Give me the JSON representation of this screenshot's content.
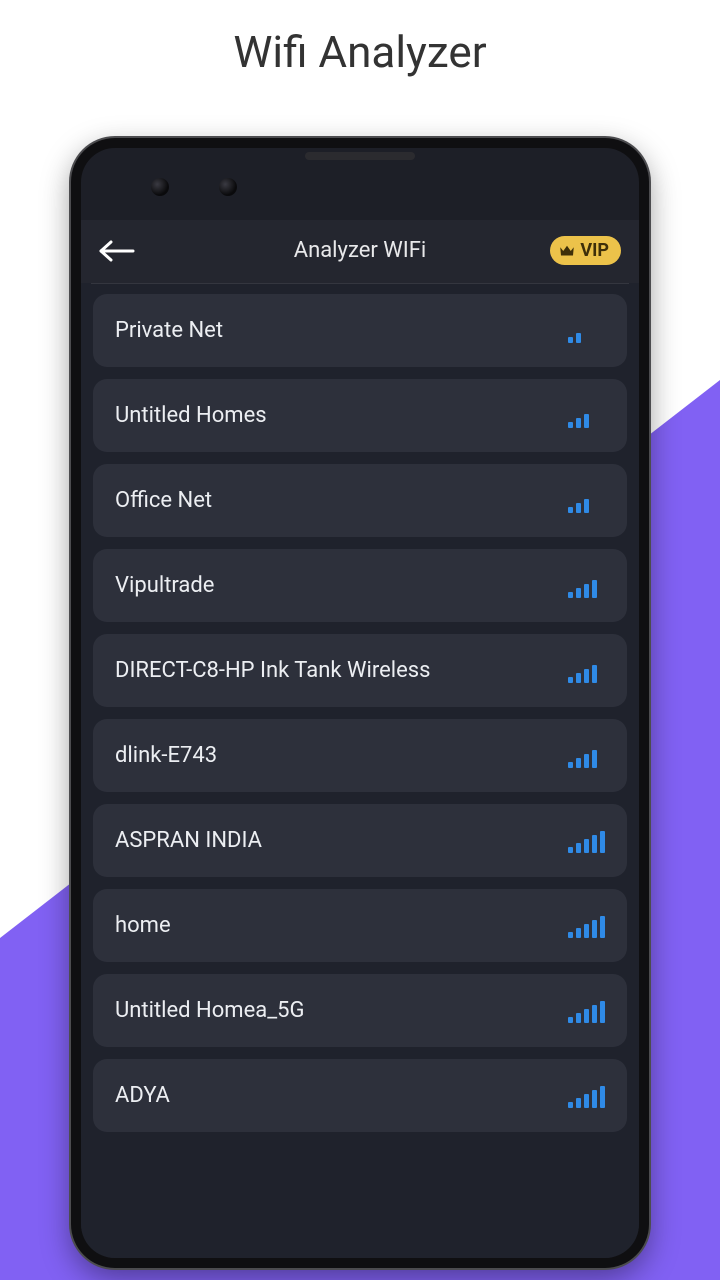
{
  "page": {
    "title": "Wifi Analyzer"
  },
  "header": {
    "title": "Analyzer WIFi",
    "vip_label": "VIP"
  },
  "networks": [
    {
      "name": "Private Net",
      "signal_bars": 2
    },
    {
      "name": "Untitled Homes",
      "signal_bars": 3
    },
    {
      "name": "Office Net",
      "signal_bars": 3
    },
    {
      "name": "Vipultrade",
      "signal_bars": 4
    },
    {
      "name": "DIRECT-C8-HP Ink Tank Wireless",
      "signal_bars": 4
    },
    {
      "name": "dlink-E743",
      "signal_bars": 4
    },
    {
      "name": "ASPRAN INDIA",
      "signal_bars": 5
    },
    {
      "name": "home",
      "signal_bars": 5
    },
    {
      "name": "Untitled Homea_5G",
      "signal_bars": 5
    },
    {
      "name": "ADYA",
      "signal_bars": 5
    }
  ]
}
